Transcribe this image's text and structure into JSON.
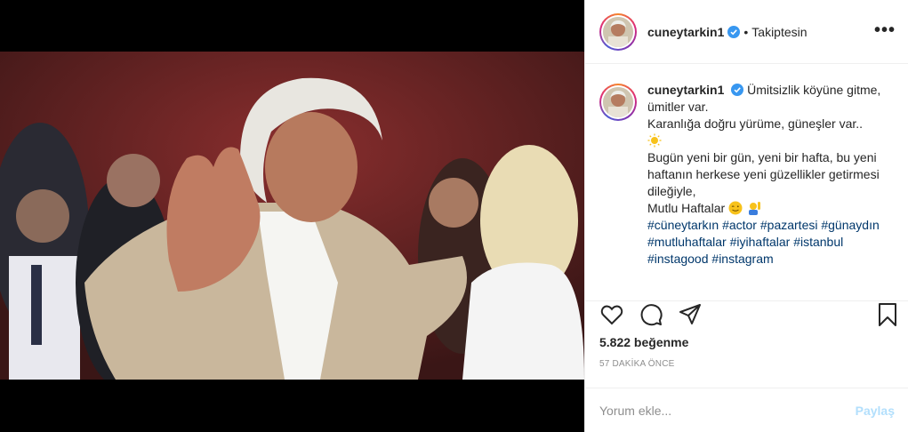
{
  "post": {
    "username": "cuneytarkin1",
    "follow_status": "Takiptesin",
    "more_label": "•••",
    "caption": {
      "username": "cuneytarkin1",
      "line1": "Ümitsizlik köyüne gitme, ümitler var.",
      "line2": "Karanlığa doğru yürüme, güneşler var..",
      "line3": "Bugün yeni bir gün, yeni bir hafta, bu yeni haftanın herkese yeni güzellikler getirmesi dileğiyle,",
      "line4": "Mutlu Haftalar",
      "hashtags": [
        "#cüneytarkın",
        "#actor",
        "#pazartesi",
        "#günaydın",
        "#mutluhaftalar",
        "#iyihaftalar",
        "#istanbul",
        "#instagood",
        "#instagram"
      ]
    },
    "likes": "5.822 beğenme",
    "time": "57 DAKİKA ÖNCE",
    "comment_placeholder": "Yorum ekle...",
    "post_button": "Paylaş"
  },
  "icons": {
    "like": "heart-icon",
    "comment": "comment-icon",
    "share": "share-icon",
    "save": "bookmark-icon",
    "verified": "verified-badge-icon"
  },
  "colors": {
    "verified": "#3897f0",
    "hashtag": "#00376b",
    "post_button_disabled": "#b2dffc",
    "muted": "#8e8e8e"
  }
}
